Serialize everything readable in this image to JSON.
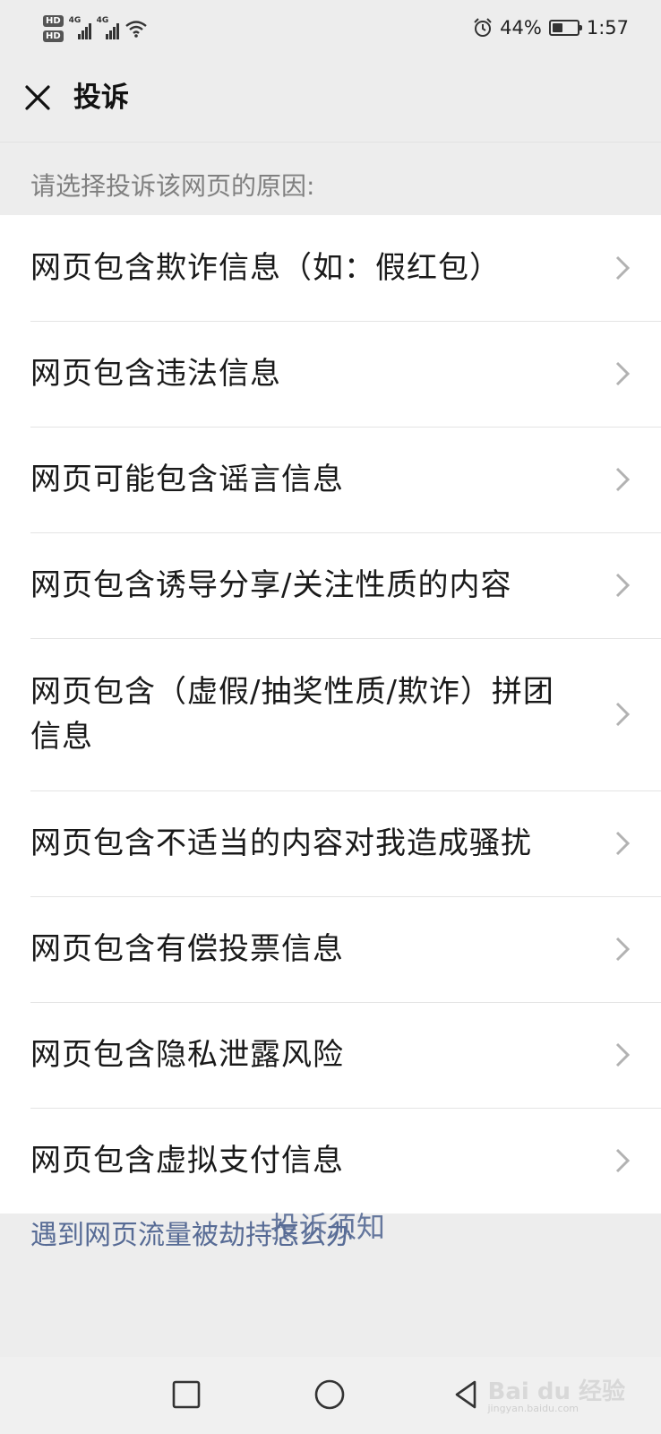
{
  "status_bar": {
    "hd1": "HD",
    "hd2": "HD",
    "sim1_type": "4G",
    "sim2_type": "4G",
    "battery_percent": "44%",
    "battery_level": 0.44,
    "time": "1:57"
  },
  "navbar": {
    "title": "投诉",
    "close_icon": "close-icon"
  },
  "section_label": "请选择投诉该网页的原因:",
  "reasons": [
    {
      "label": "网页包含欺诈信息（如：假红包）"
    },
    {
      "label": "网页包含违法信息"
    },
    {
      "label": "网页可能包含谣言信息"
    },
    {
      "label": "网页包含诱导分享/关注性质的内容"
    },
    {
      "label": "网页包含（虚假/抽奖性质/欺诈）拼团信息"
    },
    {
      "label": "网页包含不适当的内容对我造成骚扰"
    },
    {
      "label": "网页包含有偿投票信息"
    },
    {
      "label": "网页包含隐私泄露风险"
    },
    {
      "label": "网页包含虚拟支付信息"
    }
  ],
  "footer": {
    "hijack_link": "遇到网页流量被劫持怎么办",
    "notice_link": "投诉须知"
  },
  "system_nav": {
    "recents": "square-icon",
    "home": "circle-icon",
    "back": "triangle-back-icon"
  },
  "watermark": {
    "text": "Bai du 经验",
    "sub": "jingyan.baidu.com"
  },
  "colors": {
    "background": "#ededed",
    "link": "#576b95",
    "label_gray": "#808080"
  }
}
